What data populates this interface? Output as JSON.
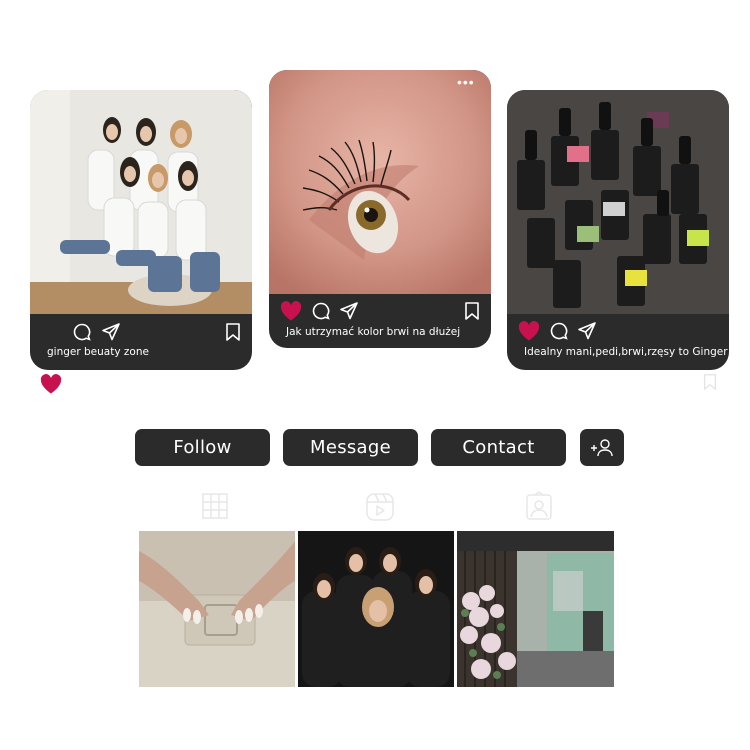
{
  "posts": [
    {
      "caption": "ginger beuaty zone",
      "liked": false,
      "photo": "group-photo-seven-women-in-white-shirts",
      "icons": [
        "comment-icon",
        "share-icon",
        "bookmark-icon"
      ]
    },
    {
      "caption": "Jak utrzymać kolor brwi na dłużej",
      "liked": true,
      "photo": "close-up-eye-with-lashes",
      "icons": [
        "heart-icon",
        "comment-icon",
        "share-icon",
        "bookmark-icon",
        "more-icon"
      ]
    },
    {
      "caption": "Idealny mani,pedi,brwi,rzęsy to Ginger",
      "liked": true,
      "photo": "nail-polish-bottles-nails-of-the-day",
      "icons": [
        "heart-icon",
        "comment-icon",
        "share-icon",
        "bookmark-icon"
      ]
    }
  ],
  "buttons": {
    "follow": "Follow",
    "message": "Message",
    "contact": "Contact",
    "add_user_icon": "add-user-icon"
  },
  "tabs": [
    "grid-icon",
    "reels-icon",
    "tagged-icon"
  ],
  "grid": [
    "manicure-hands-photo",
    "team-photo-black-shirts",
    "salon-interior-flowers-photo"
  ],
  "colors": {
    "heart": "#c8124f",
    "dark": "#2b2b2b",
    "faint_icon": "#e7e7e7"
  }
}
